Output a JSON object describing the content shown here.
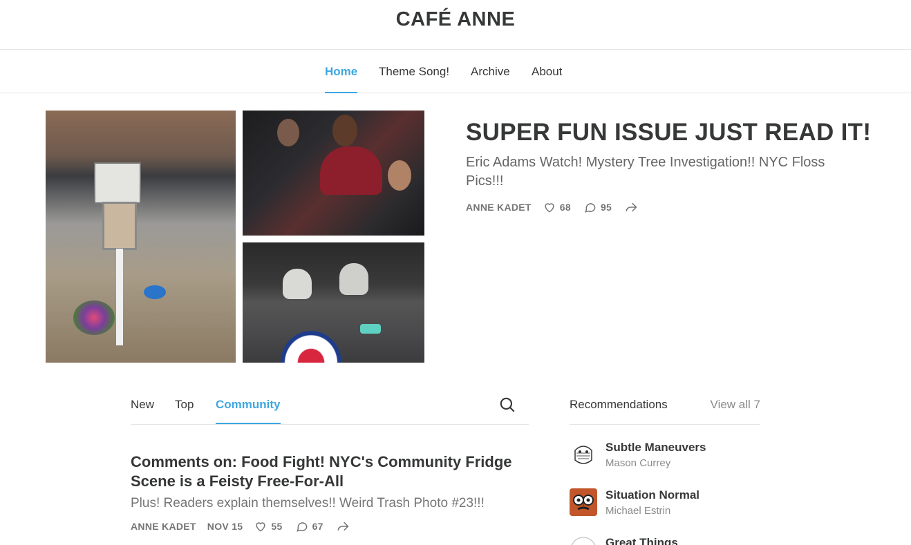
{
  "site": {
    "title": "CAFÉ ANNE"
  },
  "nav": {
    "items": [
      "Home",
      "Theme Song!",
      "Archive",
      "About"
    ],
    "active": "Home"
  },
  "hero": {
    "title": "SUPER FUN ISSUE JUST READ IT!",
    "subtitle": "Eric Adams Watch! Mystery Tree Investigation!! NYC Floss Pics!!!",
    "author": "ANNE KADET",
    "likes": "68",
    "comments": "95"
  },
  "tabs": {
    "items": [
      "New",
      "Top",
      "Community"
    ],
    "active": "Community"
  },
  "post": {
    "title": "Comments on: Food Fight! NYC's Community Fridge Scene is a Feisty Free-For-All",
    "subtitle": "Plus! Readers explain themselves!! Weird Trash Photo #23!!!",
    "author": "ANNE KADET",
    "date": "NOV 15",
    "likes": "55",
    "comments": "67"
  },
  "recommendations": {
    "title": "Recommendations",
    "view_all": "View all 7",
    "items": [
      {
        "name": "Subtle Maneuvers",
        "author": "Mason Currey"
      },
      {
        "name": "Situation Normal",
        "author": "Michael Estrin"
      },
      {
        "name": "Great Things",
        "author": ""
      }
    ]
  },
  "colors": {
    "accent": "#3ea7e0",
    "text": "#363737",
    "muted": "#757575"
  }
}
